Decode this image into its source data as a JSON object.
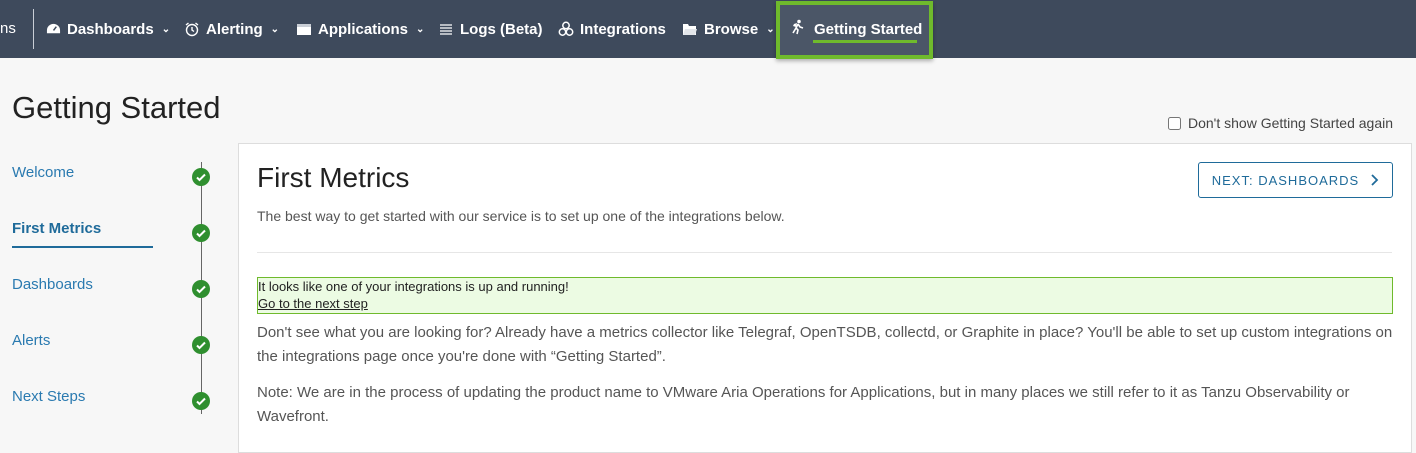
{
  "nav": {
    "cut_label": "ns",
    "items": [
      {
        "label": "Dashboards",
        "icon": "dashboard-icon"
      },
      {
        "label": "Alerting",
        "icon": "alarm-clock-icon"
      },
      {
        "label": "Applications",
        "icon": "folder-icon"
      },
      {
        "label": "Logs (Beta)",
        "icon": "list-icon"
      },
      {
        "label": "Integrations",
        "icon": "integrations-icon"
      },
      {
        "label": "Browse",
        "icon": "open-folder-icon"
      }
    ],
    "active": {
      "label": "Getting Started",
      "icon": "hiker-icon"
    },
    "highlight_color": "#6fba2c"
  },
  "page": {
    "title": "Getting Started",
    "dont_show_label": "Don't show Getting Started again"
  },
  "steps": [
    {
      "label": "Welcome",
      "done": true
    },
    {
      "label": "First Metrics",
      "done": true,
      "active": true
    },
    {
      "label": "Dashboards",
      "done": true
    },
    {
      "label": "Alerts",
      "done": true
    },
    {
      "label": "Next Steps",
      "done": true
    }
  ],
  "main": {
    "title": "First Metrics",
    "next_button": "NEXT: DASHBOARDS",
    "intro": "The best way to get started with our service is to set up one of the integrations below.",
    "alert_text": "It looks like one of your integrations is up and running!",
    "alert_link": "Go to the next step",
    "para1": "Don't see what you are looking for? Already have a metrics collector like Telegraf, OpenTSDB, collectd, or Graphite in place? You'll be able to set up custom integrations on the integrations page once you're done with “Getting Started”.",
    "para2": "Note: We are in the process of updating the product name to VMware Aria Operations for Applications, but in many places we still refer to it as Tanzu Observability or Wavefront."
  }
}
